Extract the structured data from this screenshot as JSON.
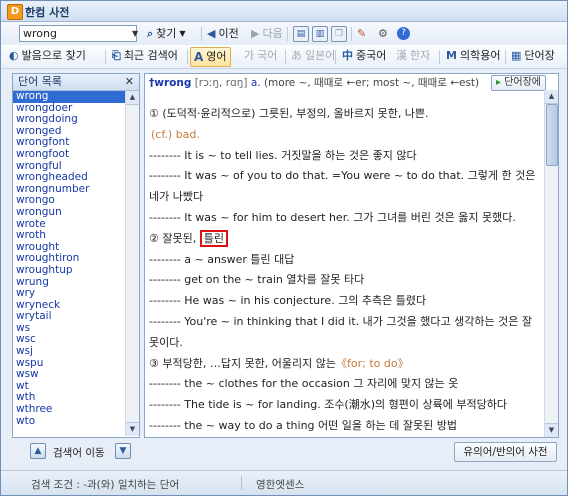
{
  "window": {
    "title": "한컴 사전",
    "icon": "D"
  },
  "toolbar": {
    "search_value": "wrong",
    "find_label": "찾기",
    "prev_label": "이전",
    "next_label": "다음"
  },
  "tabs": [
    {
      "icon": "speaker-icon",
      "label": "발음으로 찾기",
      "state": "normal"
    },
    {
      "icon": "recent-icon",
      "label": "최근 검색어",
      "state": "normal"
    },
    {
      "icon": "A",
      "label": "영어",
      "state": "active"
    },
    {
      "icon": "가",
      "label": "국어",
      "state": "disabled"
    },
    {
      "icon": "あ",
      "label": "일본어",
      "state": "disabled"
    },
    {
      "icon": "中",
      "label": "중국어",
      "state": "normal"
    },
    {
      "icon": "漢",
      "label": "한자",
      "state": "disabled"
    },
    {
      "icon": "M",
      "label": "의학용어",
      "state": "normal"
    },
    {
      "icon": "book-icon",
      "label": "단어장",
      "state": "normal"
    }
  ],
  "word_list": {
    "header": "단어 목록",
    "selected": "wrong",
    "items": [
      "wrong",
      "wrongdoer",
      "wrongdoing",
      "wronged",
      "wrongfont",
      "wrongfoot",
      "wrongful",
      "wrongheaded",
      "wrongnumber",
      "wrongo",
      "wrongun",
      "wrote",
      "wroth",
      "wrought",
      "wroughtiron",
      "wroughtup",
      "wrung",
      "wry",
      "wryneck",
      "wrytail",
      "ws",
      "wsc",
      "wsj",
      "wspu",
      "wsw",
      "wt",
      "wth",
      "wthree",
      "wto"
    ]
  },
  "entry": {
    "headword": "†wrong",
    "pron": "[rɔːŋ, rɑŋ]",
    "pos": "a.",
    "forms": "(more ~, 때때로 ←er; most ~, 때때로 ←est)",
    "vocab_button": "단어장에",
    "lines": [
      {
        "text": "① (도덕적·윤리적으로) 그릇된, 부정의, 올바르지 못한, 나쁜.",
        "style": "normal"
      },
      {
        "text": "(cf.) bad.",
        "style": "cf"
      },
      {
        "text": "-------- It is ~ to tell lies. 거짓말을 하는 것은 좋지 않다",
        "style": "normal"
      },
      {
        "text": "-------- It was ~ of you to do that. =You were ~ to do that. 그렇게 한 것은 네가 나빴다",
        "style": "wrap"
      },
      {
        "text": "-------- It was ~ for him to desert her. 그가 그녀를 버린 것은 옳지 못했다.",
        "style": "normal"
      },
      {
        "text": "② 잘못된, ",
        "highlight": "틀린",
        "style": "hl"
      },
      {
        "text": "-------- a ~ answer 틀린 대답",
        "style": "normal"
      },
      {
        "text": "-------- get on the ~ train 열차를 잘못 타다",
        "style": "normal"
      },
      {
        "text": "-------- He was ~ in his conjecture. 그의 추측은 틀렸다",
        "style": "normal"
      },
      {
        "text": "-------- You're ~ in thinking that I did it. 내가 그것을 했다고 생각하는 것은 잘못이다.",
        "style": "wrap"
      },
      {
        "text": "③ 부적당한, …답지 못한, 어울리지 않는",
        "extra": "《for; to do》",
        "style": "extra"
      },
      {
        "text": "-------- the ~ clothes for the occasion 그 자리에 맞지 않는 옷",
        "style": "normal"
      },
      {
        "text": "-------- The tide is ~ for landing. 조수(潮水)의 형편이 상륙에 부적당하다",
        "style": "normal"
      },
      {
        "text": "-------- the ~ way to do a thing 어떤 일을 하는 데 잘못된 방법",
        "style": "normal"
      }
    ]
  },
  "bottom": {
    "move_label": "검색어 이동",
    "syn_button": "유의어/반의어 사전"
  },
  "status": {
    "condition": "검색 조건 : -과(와) 일치하는 단어",
    "source": "영한엣센스"
  }
}
